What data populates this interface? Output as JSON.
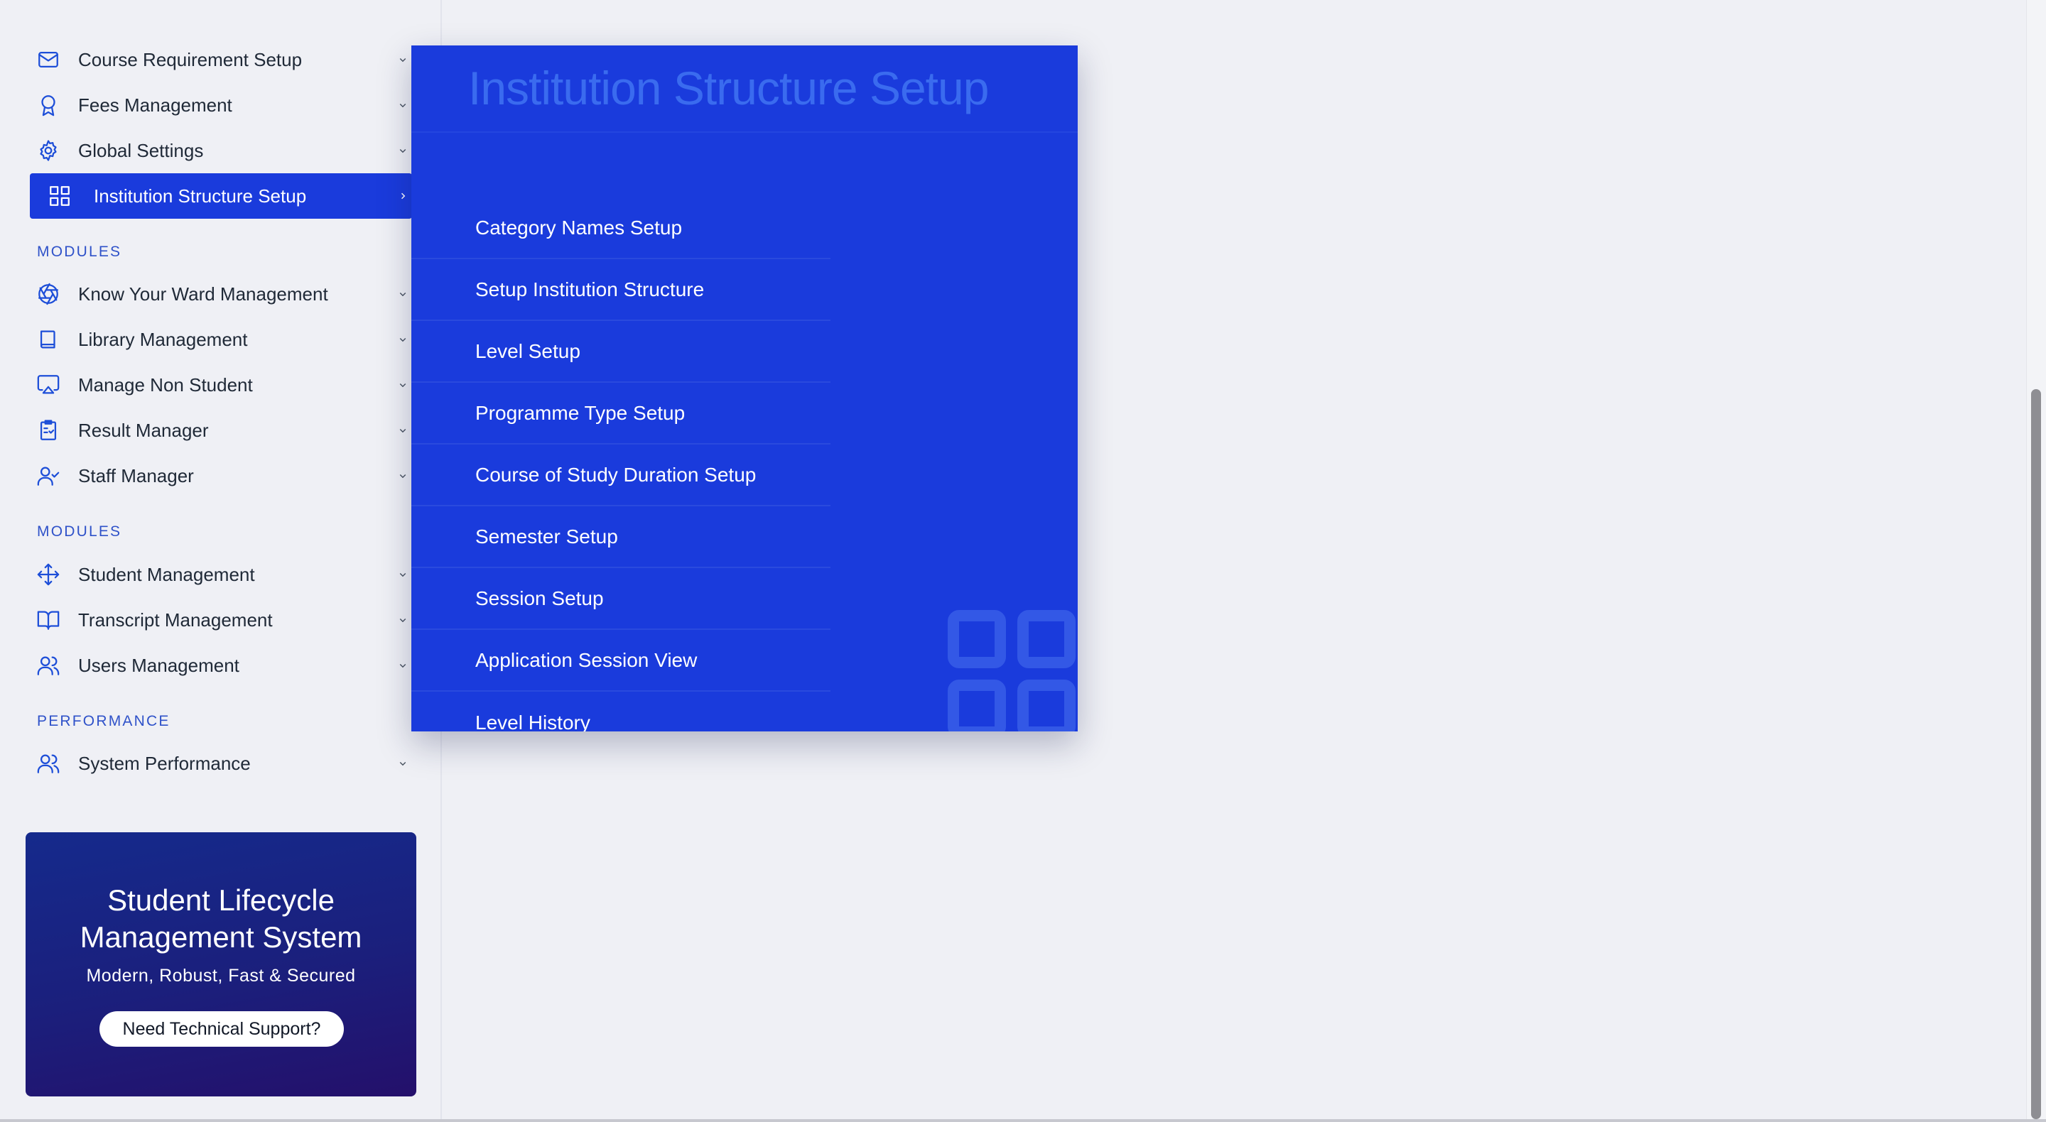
{
  "sidebar": {
    "items_top": [
      {
        "label": "Course Requirement Setup",
        "icon": "mail-icon"
      },
      {
        "label": "Fees Management",
        "icon": "award-icon"
      },
      {
        "label": "Global Settings",
        "icon": "gear-icon"
      },
      {
        "label": "Institution Structure Setup",
        "icon": "grid-icon",
        "active": true
      }
    ],
    "section_1": "MODULES",
    "items_modules_1": [
      {
        "label": "Know Your Ward Management",
        "icon": "aperture-icon"
      },
      {
        "label": "Library Management",
        "icon": "book-icon"
      },
      {
        "label": "Manage Non Student",
        "icon": "airplay-icon"
      },
      {
        "label": "Result Manager",
        "icon": "clipboard-check-icon"
      },
      {
        "label": "Staff Manager",
        "icon": "user-check-icon"
      }
    ],
    "section_2": "MODULES",
    "items_modules_2": [
      {
        "label": "Student Management",
        "icon": "move-icon"
      },
      {
        "label": "Transcript Management",
        "icon": "book-open-icon"
      },
      {
        "label": "Users Management",
        "icon": "users-icon"
      }
    ],
    "section_3": "PERFORMANCE",
    "items_performance": [
      {
        "label": "System Performance",
        "icon": "users-icon"
      }
    ]
  },
  "promo": {
    "title_line1": "Student Lifecycle",
    "title_line2": "Management System",
    "subtitle": "Modern, Robust, Fast & Secured",
    "button_label": "Need Technical Support?"
  },
  "flyout": {
    "title": "Institution Structure Setup",
    "items": [
      "Category Names Setup",
      "Setup Institution Structure",
      "Level Setup",
      "Programme Type Setup",
      "Course of Study Duration Setup",
      "Semester Setup",
      "Session Setup",
      "Application Session View",
      "Level History"
    ]
  },
  "colors": {
    "accent": "#1a3bdc",
    "section_label": "#2f52c9",
    "background": "#eff0f5"
  }
}
